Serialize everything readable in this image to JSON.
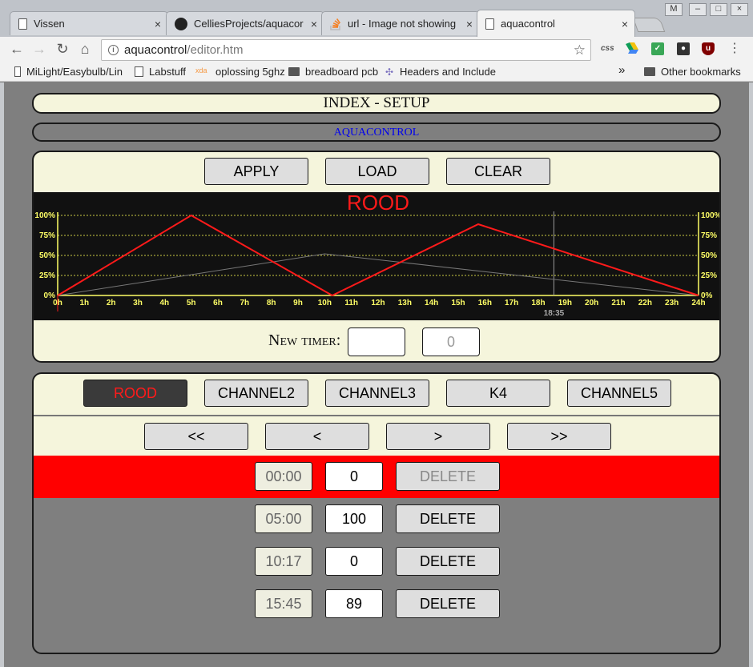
{
  "browser": {
    "tabs": [
      {
        "title": "Vissen",
        "icon": "document-icon",
        "active": false
      },
      {
        "title": "CelliesProjects/aquacor",
        "icon": "github-icon",
        "active": false
      },
      {
        "title": "url - Image not showing",
        "icon": "stackoverflow-icon",
        "active": false
      },
      {
        "title": "aquacontrol",
        "icon": "document-icon",
        "active": true
      }
    ],
    "close_glyph": "×",
    "url_host": "aquacontrol",
    "url_path": "/editor.htm",
    "bookmarks": [
      {
        "label": "MiLight/Easybulb/Lin",
        "icon": "page-icon"
      },
      {
        "label": "Labstuff",
        "icon": "page-icon"
      },
      {
        "label": "oplossing 5ghz",
        "icon": "xda-icon"
      },
      {
        "label": "breadboard pcb",
        "icon": "folder-icon"
      },
      {
        "label": "Headers and Include",
        "icon": "puzzle-icon"
      }
    ],
    "bookmarks_overflow": "»",
    "other_bookmarks": "Other bookmarks",
    "window_badge": "M"
  },
  "page": {
    "title": "INDEX - SETUP",
    "subtitle_link": "AQUACONTROL",
    "actions": {
      "apply": "APPLY",
      "load": "LOAD",
      "clear": "CLEAR"
    },
    "new_timer_label": "New timer:",
    "new_timer_time": "",
    "new_timer_value_placeholder": "0",
    "channels": [
      {
        "label": "ROOD",
        "active": true
      },
      {
        "label": "CHANNEL2",
        "active": false
      },
      {
        "label": "CHANNEL3",
        "active": false
      },
      {
        "label": "K4",
        "active": false
      },
      {
        "label": "CHANNEL5",
        "active": false
      }
    ],
    "nav": {
      "first": "<<",
      "prev": "<",
      "next": ">",
      "last": ">>"
    },
    "timers": [
      {
        "time": "00:00",
        "value": "0",
        "delete": "DELETE",
        "selected": true
      },
      {
        "time": "05:00",
        "value": "100",
        "delete": "DELETE",
        "selected": false
      },
      {
        "time": "10:17",
        "value": "0",
        "delete": "DELETE",
        "selected": false
      },
      {
        "time": "15:45",
        "value": "89",
        "delete": "DELETE",
        "selected": false
      }
    ]
  },
  "chart_data": {
    "type": "line",
    "title": "ROOD",
    "xlabel": "",
    "ylabel": "",
    "x_ticks": [
      "0h",
      "1h",
      "2h",
      "3h",
      "4h",
      "5h",
      "6h",
      "7h",
      "8h",
      "9h",
      "10h",
      "11h",
      "12h",
      "13h",
      "14h",
      "15h",
      "16h",
      "17h",
      "18h",
      "19h",
      "20h",
      "21h",
      "22h",
      "23h",
      "24h"
    ],
    "y_ticks": [
      "0%",
      "25%",
      "50%",
      "75%",
      "100%"
    ],
    "xlim": [
      0,
      24
    ],
    "ylim": [
      0,
      100
    ],
    "grid": true,
    "current_time_label": "18:35",
    "current_time_hours": 18.583,
    "colors": {
      "active": "#ff1a1a",
      "inactive": "#777777",
      "axis": "#ffff66",
      "grid": "#cccc44",
      "background": "#111111"
    },
    "series": [
      {
        "name": "ROOD",
        "x": [
          0,
          5,
          10.283,
          15.75,
          24
        ],
        "y": [
          0,
          100,
          0,
          89,
          0
        ]
      },
      {
        "x": [
          0,
          10,
          24
        ],
        "y": [
          0,
          52,
          0
        ]
      }
    ]
  }
}
